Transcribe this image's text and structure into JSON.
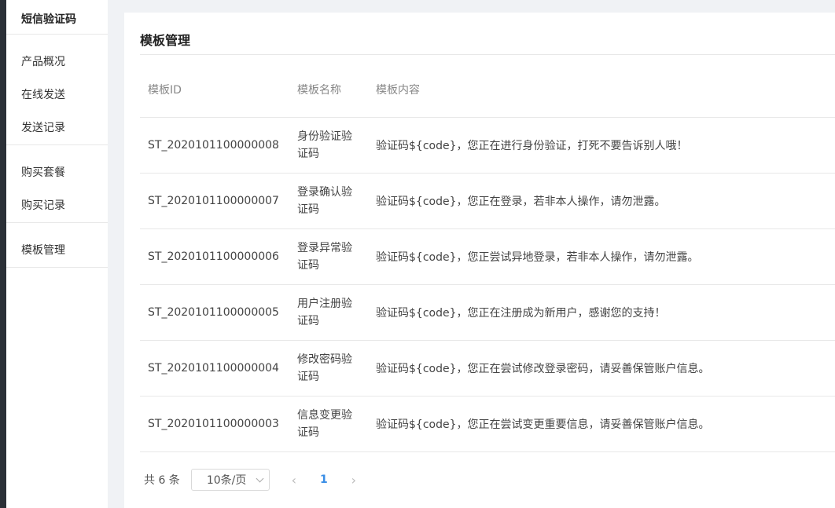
{
  "sidebar": {
    "title": "短信验证码",
    "groups": [
      [
        "产品概况",
        "在线发送",
        "发送记录"
      ],
      [
        "购买套餐",
        "购买记录"
      ],
      [
        "模板管理"
      ]
    ]
  },
  "main": {
    "title": "模板管理",
    "columns": [
      "模板ID",
      "模板名称",
      "模板内容"
    ],
    "rows": [
      {
        "id": "ST_2020101100000008",
        "name": "身份验证验证码",
        "content": "验证码${code}，您正在进行身份验证，打死不要告诉别人哦！"
      },
      {
        "id": "ST_2020101100000007",
        "name": "登录确认验证码",
        "content": "验证码${code}，您正在登录，若非本人操作，请勿泄露。"
      },
      {
        "id": "ST_2020101100000006",
        "name": "登录异常验证码",
        "content": "验证码${code}，您正尝试异地登录，若非本人操作，请勿泄露。"
      },
      {
        "id": "ST_2020101100000005",
        "name": "用户注册验证码",
        "content": "验证码${code}，您正在注册成为新用户，感谢您的支持！"
      },
      {
        "id": "ST_2020101100000004",
        "name": "修改密码验证码",
        "content": "验证码${code}，您正在尝试修改登录密码，请妥善保管账户信息。"
      },
      {
        "id": "ST_2020101100000003",
        "name": "信息变更验证码",
        "content": "验证码${code}，您正在尝试变更重要信息，请妥善保管账户信息。"
      }
    ]
  },
  "pager": {
    "total": "共 6 条",
    "page_size": "10条/页",
    "prev": "‹",
    "next": "›",
    "current": "1"
  }
}
